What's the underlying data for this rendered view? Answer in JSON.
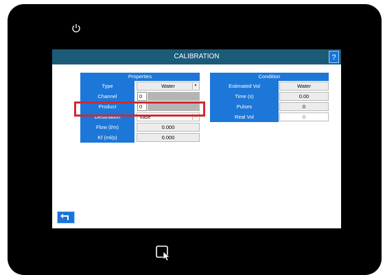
{
  "title": "CALIBRATION",
  "help_label": "?",
  "properties": {
    "header": "Properties",
    "rows": [
      {
        "label": "Type",
        "value": "Water",
        "kind": "dropdown"
      },
      {
        "label": "Channel",
        "value": "0",
        "kind": "number"
      },
      {
        "label": "Product",
        "value": "0",
        "kind": "number"
      },
      {
        "label": "Destination",
        "value": "Vase",
        "kind": "dropdown"
      },
      {
        "label": "Flow (l/m)",
        "value": "0.000",
        "kind": "field"
      },
      {
        "label": "Kf (ml/p)",
        "value": "0.000",
        "kind": "field"
      }
    ]
  },
  "condition": {
    "header": "Condition",
    "rows": [
      {
        "label": "Estimated Vol",
        "value": "Water"
      },
      {
        "label": "Time (s)",
        "value": "0.00"
      },
      {
        "label": "Pulses",
        "value": "0"
      },
      {
        "label": "Real Vol",
        "value": "0"
      }
    ]
  },
  "colors": {
    "accent": "#1c77d8",
    "titlebar": "#1b5b78",
    "highlight": "#d12a2f"
  },
  "icons": {
    "power": "power-icon",
    "help": "help-icon",
    "back": "back-arrow-icon",
    "touch": "touch-icon"
  }
}
